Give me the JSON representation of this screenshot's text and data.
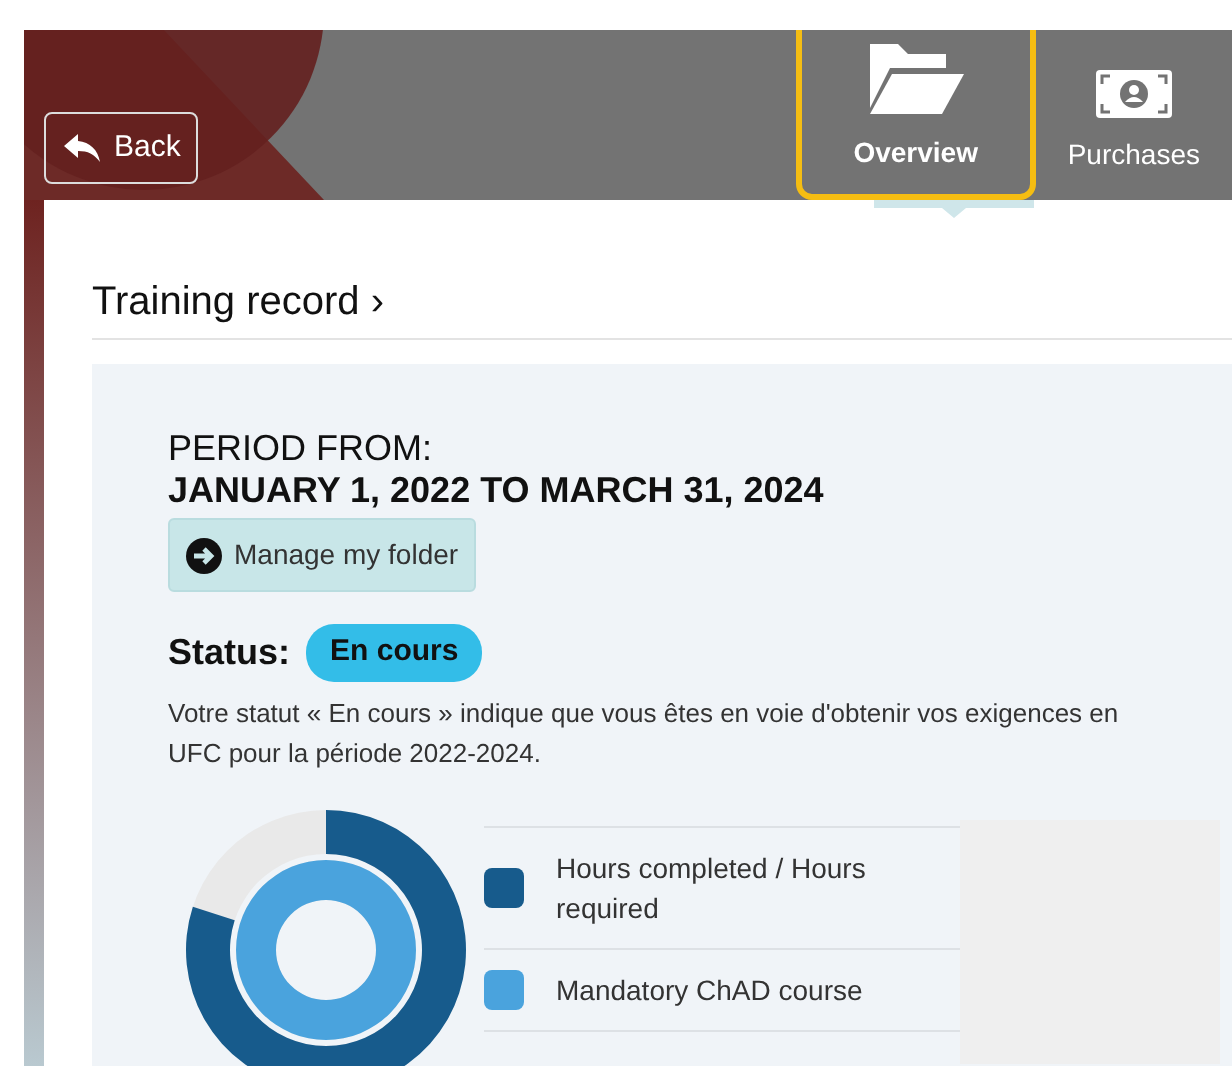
{
  "header": {
    "back_label": "Back",
    "tabs": [
      {
        "label": "Overview",
        "selected": true
      },
      {
        "label": "Purchases",
        "selected": false
      }
    ]
  },
  "section": {
    "title": "Training record",
    "chevron": "›"
  },
  "period": {
    "label": "PERIOD FROM:",
    "range": "JANUARY 1, 2022 TO MARCH 31, 2024",
    "manage_button": "Manage my folder"
  },
  "status": {
    "label": "Status:",
    "badge": "En cours",
    "description": "Votre statut « En cours » indique que vous êtes en voie d'obtenir vos exigences en UFC pour la période 2022-2024."
  },
  "legend": [
    {
      "label": "Hours completed / Hours required",
      "color": "#175b8c"
    },
    {
      "label": "Mandatory ChAD course",
      "color": "#4aa3dd"
    }
  ]
}
